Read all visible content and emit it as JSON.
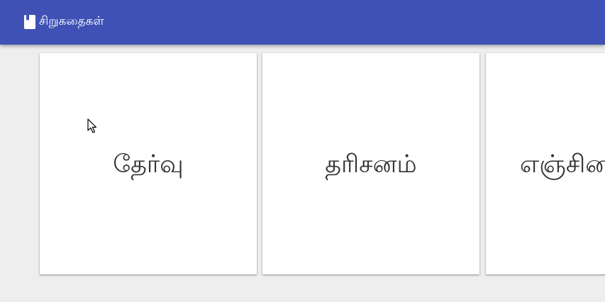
{
  "app": {
    "title": "சிறுகதைகள்",
    "icon": "book-icon",
    "colors": {
      "appbar": "#3f51b5",
      "background": "#eeeeee",
      "card": "#ffffff"
    }
  },
  "stories": [
    {
      "title": "தேர்வு"
    },
    {
      "title": "தரிசனம்"
    },
    {
      "title": "எஞ்சின"
    }
  ]
}
